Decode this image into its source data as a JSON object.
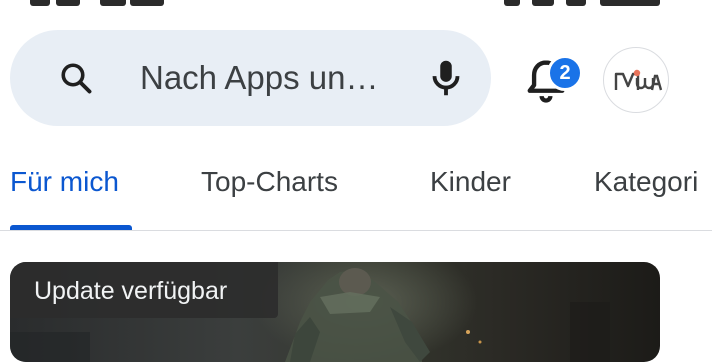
{
  "search": {
    "placeholder_text": "Nach Apps un…"
  },
  "notifications": {
    "count": "2"
  },
  "account": {
    "avatar_text": "MWA"
  },
  "tabs": [
    {
      "label": "Für mich",
      "active": true
    },
    {
      "label": "Top-Charts",
      "active": false
    },
    {
      "label": "Kinder",
      "active": false
    },
    {
      "label": "Kategori",
      "active": false
    }
  ],
  "card": {
    "badge_label": "Update verfügbar"
  },
  "colors": {
    "accent": "#0b57d0",
    "search_bg": "#e8eef5",
    "badge": "#1a73e8",
    "text": "#3c4043"
  },
  "icons": {
    "search": "search-icon",
    "mic": "mic-icon",
    "bell": "bell-icon"
  }
}
